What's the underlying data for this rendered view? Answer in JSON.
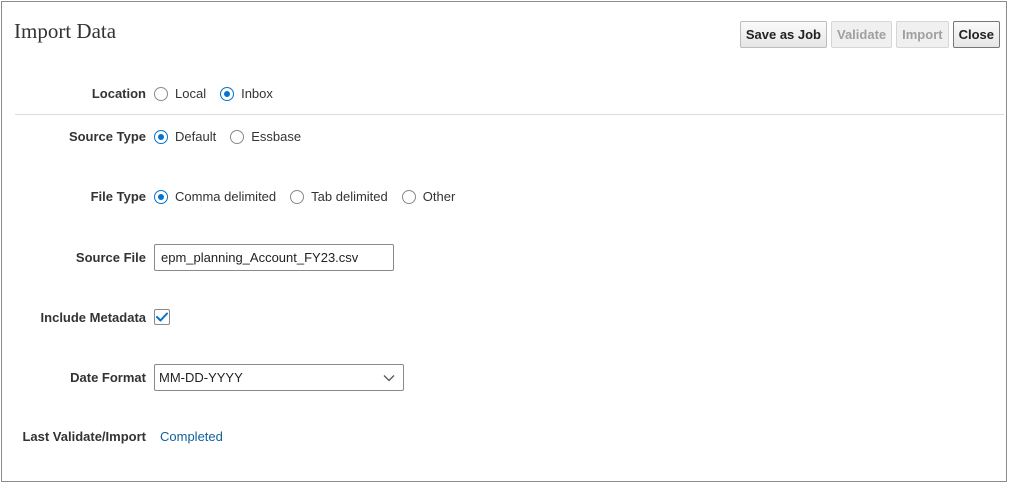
{
  "page": {
    "title": "Import Data"
  },
  "toolbar": {
    "save_as_job": "Save as Job",
    "validate": "Validate",
    "import": "Import",
    "close": "Close"
  },
  "form": {
    "location": {
      "label": "Location",
      "options": [
        "Local",
        "Inbox"
      ],
      "selected": "Inbox"
    },
    "source_type": {
      "label": "Source Type",
      "options": [
        "Default",
        "Essbase"
      ],
      "selected": "Default"
    },
    "file_type": {
      "label": "File Type",
      "options": [
        "Comma delimited",
        "Tab delimited",
        "Other"
      ],
      "selected": "Comma delimited"
    },
    "source_file": {
      "label": "Source File",
      "value": "epm_planning_Account_FY23.csv"
    },
    "include_metadata": {
      "label": "Include Metadata",
      "checked": true
    },
    "date_format": {
      "label": "Date Format",
      "value": "MM-DD-YYYY"
    },
    "last_validate_import": {
      "label": "Last Validate/Import",
      "status": "Completed"
    }
  },
  "colors": {
    "accent": "#0572ce",
    "link": "#0f5f9c",
    "disabled_text": "#9f9f9f"
  },
  "icons": {
    "checkbox": "checkmark-icon",
    "dropdown": "chevron-down-icon"
  }
}
